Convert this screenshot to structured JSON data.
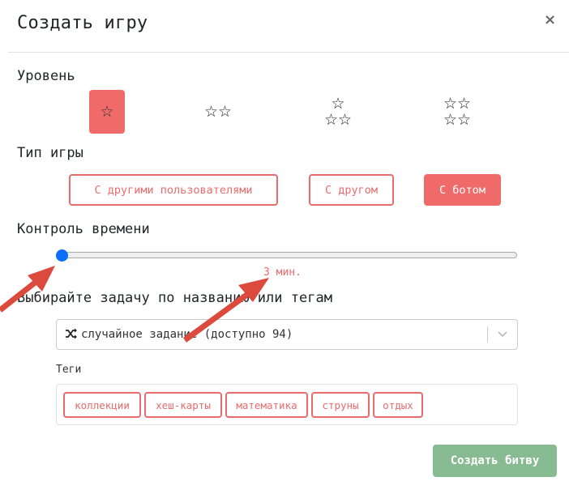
{
  "modal": {
    "title": "Создать игру",
    "close_symbol": "×"
  },
  "level": {
    "label": "Уровень",
    "options": [
      {
        "rows": [
          "☆"
        ],
        "selected": true
      },
      {
        "rows": [
          "☆☆"
        ],
        "selected": false
      },
      {
        "rows": [
          "☆",
          "☆☆"
        ],
        "selected": false
      },
      {
        "rows": [
          "☆☆",
          "☆☆"
        ],
        "selected": false
      }
    ]
  },
  "game_type": {
    "label": "Тип игры",
    "options": [
      "С другими пользователями",
      "С другом",
      "С ботом"
    ],
    "selected": "С ботом"
  },
  "time_control": {
    "label": "Контроль времени",
    "value_text": "3 мин.",
    "slider_fraction": 0
  },
  "task": {
    "label": "Выбирайте задачу по названию или тегам",
    "select_value": "случайное задание (доступно 94)",
    "icons": {
      "shuffle": "shuffle-icon",
      "dropdown": "chevron-down-icon"
    }
  },
  "tags": {
    "label": "Теги",
    "items": [
      "коллекции",
      "хеш-карты",
      "математика",
      "струны",
      "отдых"
    ]
  },
  "actions": {
    "create_label": "Создать битву"
  },
  "colors": {
    "accent": "#f06a6a",
    "accent_text": "#e96c6c",
    "slider_thumb": "#0d6efd",
    "create_button": "#88bb92",
    "annotation_arrow": "#dc4a3d"
  }
}
